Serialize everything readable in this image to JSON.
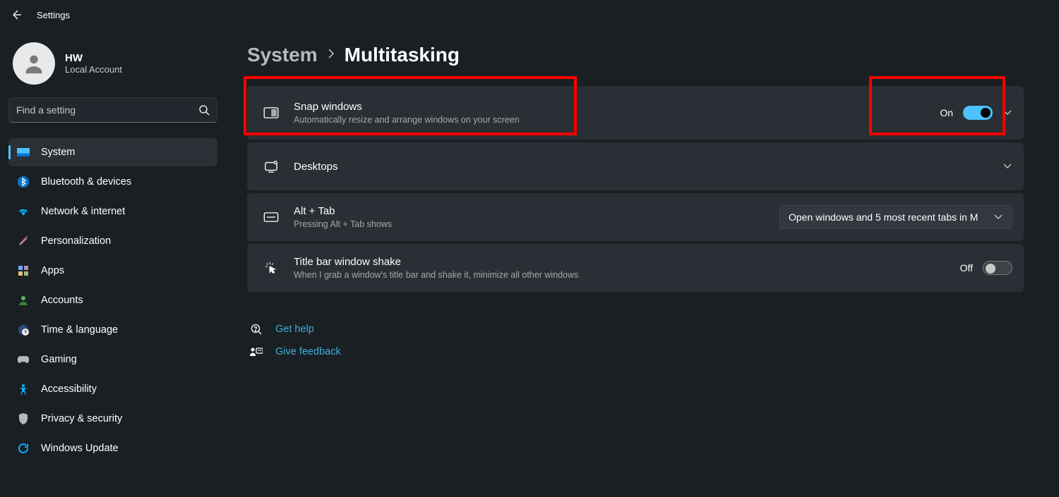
{
  "app": {
    "title": "Settings"
  },
  "account": {
    "name": "HW",
    "sub": "Local Account"
  },
  "search": {
    "placeholder": "Find a setting"
  },
  "sidebar": {
    "items": [
      {
        "label": "System"
      },
      {
        "label": "Bluetooth & devices"
      },
      {
        "label": "Network & internet"
      },
      {
        "label": "Personalization"
      },
      {
        "label": "Apps"
      },
      {
        "label": "Accounts"
      },
      {
        "label": "Time & language"
      },
      {
        "label": "Gaming"
      },
      {
        "label": "Accessibility"
      },
      {
        "label": "Privacy & security"
      },
      {
        "label": "Windows Update"
      }
    ]
  },
  "breadcrumb": {
    "parent": "System",
    "current": "Multitasking"
  },
  "rows": {
    "snap": {
      "title": "Snap windows",
      "desc": "Automatically resize and arrange windows on your screen",
      "state": "On"
    },
    "desktops": {
      "title": "Desktops"
    },
    "alttab": {
      "title": "Alt + Tab",
      "desc": "Pressing Alt + Tab shows",
      "combo": "Open windows and 5 most recent tabs in M"
    },
    "shake": {
      "title": "Title bar window shake",
      "desc": "When I grab a window's title bar and shake it, minimize all other windows",
      "state": "Off"
    }
  },
  "footer": {
    "help": "Get help",
    "feedback": "Give feedback"
  }
}
